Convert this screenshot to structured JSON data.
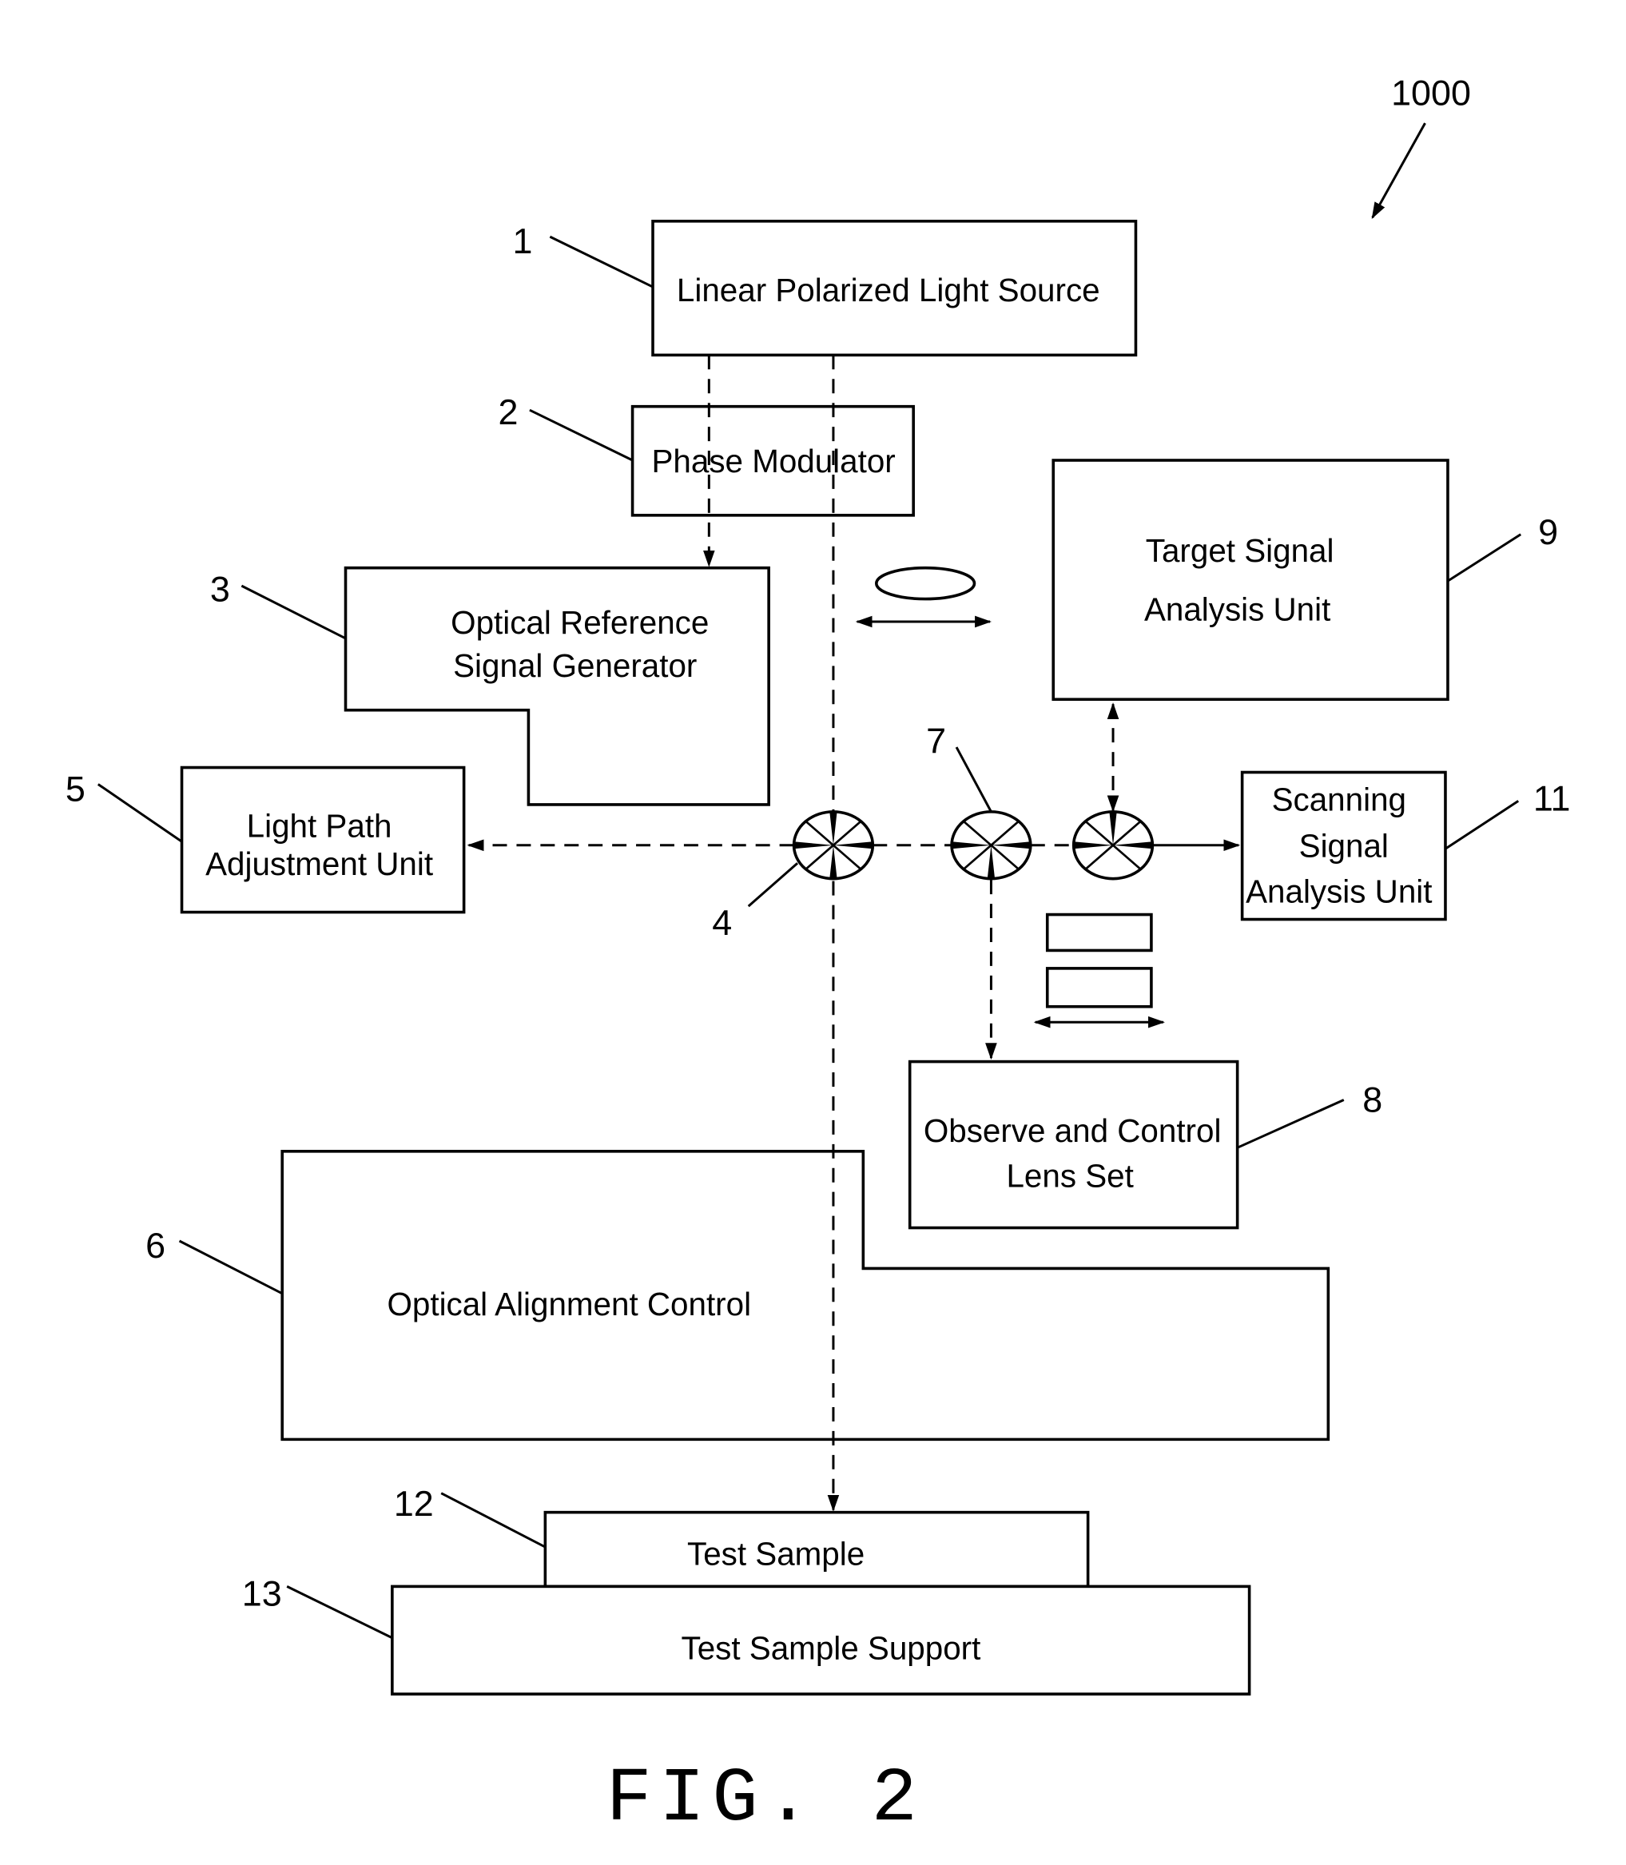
{
  "figure": {
    "caption": "FIG. 2",
    "system_ref": "1000"
  },
  "components": {
    "light_source": {
      "ref": "1",
      "label": "Linear Polarized Light Source"
    },
    "phase_modulator": {
      "ref": "2",
      "label": "Phase Modulator"
    },
    "optical_reference": {
      "ref": "3",
      "lines": [
        "Optical Reference",
        "Signal Generator"
      ]
    },
    "beam_splitter_4": {
      "ref": "4"
    },
    "light_path": {
      "ref": "5",
      "lines": [
        "Light Path",
        "Adjustment Unit"
      ]
    },
    "alignment_control": {
      "ref": "6",
      "label": "Optical Alignment Control"
    },
    "beam_splitter_7": {
      "ref": "7"
    },
    "observe_lens": {
      "ref": "8",
      "lines": [
        "Observe and Control",
        "Lens Set"
      ]
    },
    "target_signal": {
      "ref": "9",
      "lines": [
        "Target Signal",
        "Analysis Unit"
      ]
    },
    "scanning_signal": {
      "ref": "11",
      "lines": [
        "Scanning",
        "Signal",
        "Analysis Unit"
      ]
    },
    "test_sample": {
      "ref": "12",
      "label": "Test Sample"
    },
    "test_sample_support": {
      "ref": "13",
      "label": "Test Sample Support"
    }
  }
}
